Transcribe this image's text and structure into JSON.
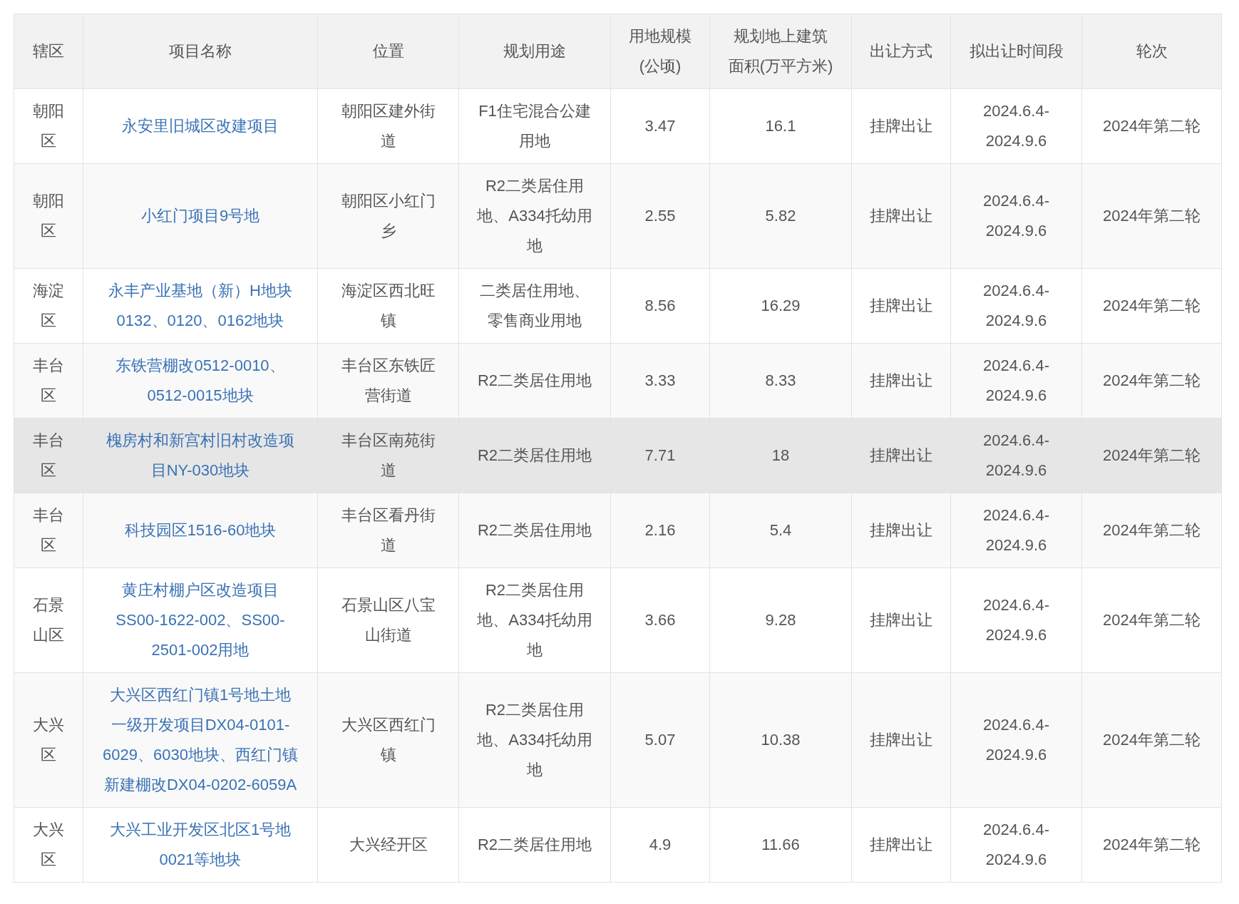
{
  "table": {
    "columns": [
      "辖区",
      "项目名称",
      "位置",
      "规划用途",
      "用地规模(公顷)",
      "规划地上建筑面积(万平方米)",
      "出让方式",
      "拟出让时间段",
      "轮次"
    ],
    "rows": [
      {
        "district": "朝阳区",
        "project": "永安里旧城区改建项目",
        "location": "朝阳区建外街道",
        "use": "F1住宅混合公建用地",
        "area": "3.47",
        "floor_area": "16.1",
        "method": "挂牌出让",
        "period": "2024.6.4-2024.9.6",
        "round": "2024年第二轮",
        "highlighted": false
      },
      {
        "district": "朝阳区",
        "project": "小红门项目9号地",
        "location": "朝阳区小红门乡",
        "use": "R2二类居住用地、A334托幼用地",
        "area": "2.55",
        "floor_area": "5.82",
        "method": "挂牌出让",
        "period": "2024.6.4-2024.9.6",
        "round": "2024年第二轮",
        "highlighted": false
      },
      {
        "district": "海淀区",
        "project": "永丰产业基地（新）H地块0132、0120、0162地块",
        "location": "海淀区西北旺镇",
        "use": "二类居住用地、零售商业用地",
        "area": "8.56",
        "floor_area": "16.29",
        "method": "挂牌出让",
        "period": "2024.6.4-2024.9.6",
        "round": "2024年第二轮",
        "highlighted": false
      },
      {
        "district": "丰台区",
        "project": "东铁营棚改0512-0010、0512-0015地块",
        "location": "丰台区东铁匠营街道",
        "use": "R2二类居住用地",
        "area": "3.33",
        "floor_area": "8.33",
        "method": "挂牌出让",
        "period": "2024.6.4-2024.9.6",
        "round": "2024年第二轮",
        "highlighted": false
      },
      {
        "district": "丰台区",
        "project": "槐房村和新宫村旧村改造项目NY-030地块",
        "location": "丰台区南苑街道",
        "use": "R2二类居住用地",
        "area": "7.71",
        "floor_area": "18",
        "method": "挂牌出让",
        "period": "2024.6.4-2024.9.6",
        "round": "2024年第二轮",
        "highlighted": true
      },
      {
        "district": "丰台区",
        "project": "科技园区1516-60地块",
        "location": "丰台区看丹街道",
        "use": "R2二类居住用地",
        "area": "2.16",
        "floor_area": "5.4",
        "method": "挂牌出让",
        "period": "2024.6.4-2024.9.6",
        "round": "2024年第二轮",
        "highlighted": false
      },
      {
        "district": "石景山区",
        "project": "黄庄村棚户区改造项目SS00-1622-002、SS00-2501-002用地",
        "location": "石景山区八宝山街道",
        "use": "R2二类居住用地、A334托幼用地",
        "area": "3.66",
        "floor_area": "9.28",
        "method": "挂牌出让",
        "period": "2024.6.4-2024.9.6",
        "round": "2024年第二轮",
        "highlighted": false
      },
      {
        "district": "大兴区",
        "project": "大兴区西红门镇1号地土地一级开发项目DX04-0101-6029、6030地块、西红门镇新建棚改DX04-0202-6059A",
        "location": "大兴区西红门镇",
        "use": "R2二类居住用地、A334托幼用地",
        "area": "5.07",
        "floor_area": "10.38",
        "method": "挂牌出让",
        "period": "2024.6.4-2024.9.6",
        "round": "2024年第二轮",
        "highlighted": false
      },
      {
        "district": "大兴区",
        "project": "大兴工业开发区北区1号地0021等地块",
        "location": "大兴经开区",
        "use": "R2二类居住用地",
        "area": "4.9",
        "floor_area": "11.66",
        "method": "挂牌出让",
        "period": "2024.6.4-2024.9.6",
        "round": "2024年第二轮",
        "highlighted": false
      }
    ]
  }
}
